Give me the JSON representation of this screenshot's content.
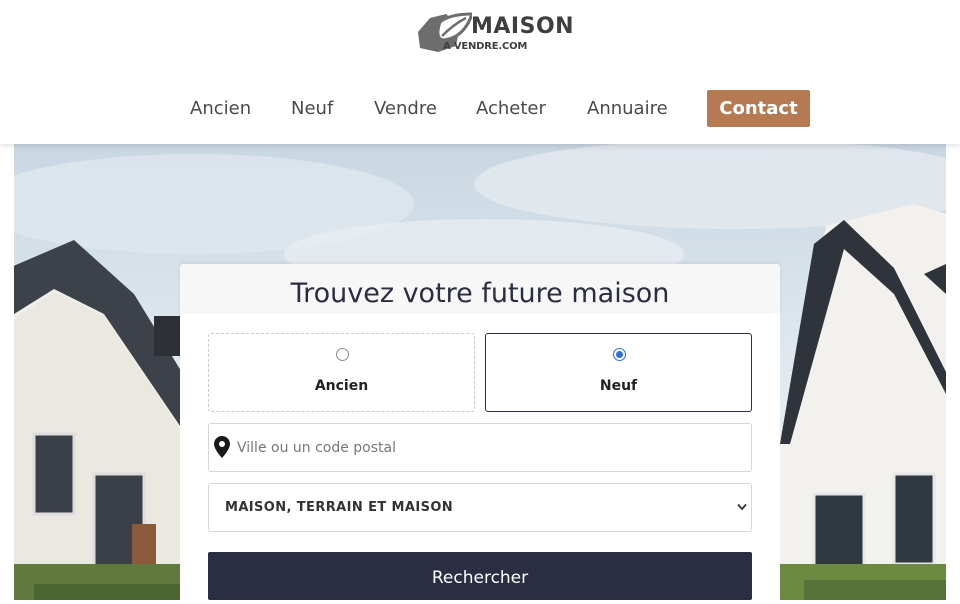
{
  "brand": {
    "name": "MAISON",
    "subline": "A VENDRE.COM"
  },
  "nav": {
    "items": [
      {
        "label": "Ancien"
      },
      {
        "label": "Neuf"
      },
      {
        "label": "Vendre"
      },
      {
        "label": "Acheter"
      },
      {
        "label": "Annuaire"
      }
    ],
    "contact_label": "Contact"
  },
  "search": {
    "title": "Trouvez votre future maison",
    "options": [
      {
        "label": "Ancien",
        "selected": false
      },
      {
        "label": "Neuf",
        "selected": true
      }
    ],
    "city_placeholder": "Ville ou un code postal",
    "city_value": "",
    "type_selected": "MAISON, TERRAIN ET MAISON",
    "submit_label": "Rechercher"
  },
  "colors": {
    "accent": "#b57a52",
    "primary": "#2b2d42",
    "radio_checked": "#2f6fe0"
  },
  "icons": [
    "logo-leaf-icon",
    "map-pin-icon",
    "chevron-down-icon"
  ]
}
